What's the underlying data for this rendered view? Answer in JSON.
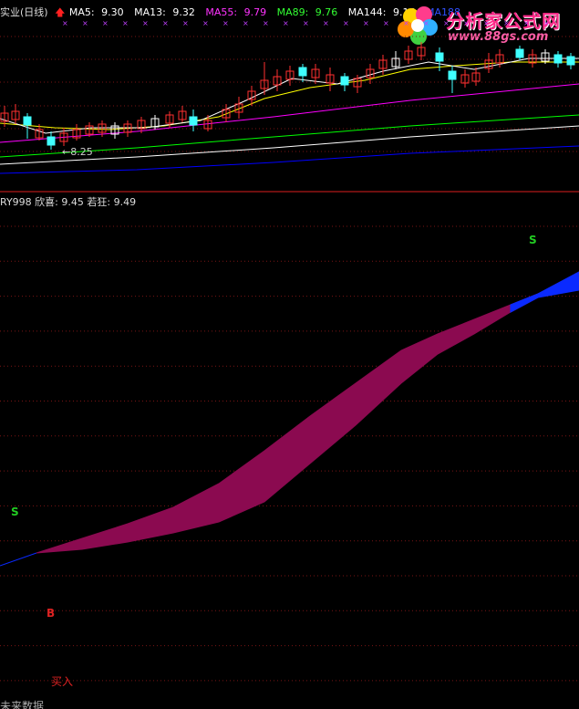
{
  "header": {
    "stock": "实业(日线)",
    "ma5_label": "MA5:",
    "ma5_value": "9.30",
    "ma13_label": "MA13:",
    "ma13_value": "9.32",
    "ma55_label": "MA55:",
    "ma55_value": "9.79",
    "ma89_label": "MA89:",
    "ma89_value": "9.76",
    "ma144_label": "MA144:",
    "ma144_value": "9.16",
    "ma188_label": "MA188",
    "low_marker": "8.25"
  },
  "indicator": {
    "name": "RY998",
    "label1": "欣喜:",
    "value1": "9.45",
    "label2": "若狂:",
    "value2": "9.49"
  },
  "signals": {
    "s_left": "S",
    "s_right": "S",
    "b": "B",
    "buy": "买入",
    "future": "未来数据"
  },
  "logo": {
    "title": "分析家公式网",
    "url": "www.88gs.com"
  },
  "colors": {
    "ma5": "#ffffff",
    "ma13": "#ffff00",
    "ma55": "#ff00ff",
    "ma89": "#00ff00",
    "ma144": "#ffffff",
    "ma188": "#0000ff",
    "ribbon_up": "#8b0a50",
    "ribbon_down": "#0a2aff"
  },
  "chart_data": [
    {
      "type": "line",
      "title": "实业(日线)",
      "series": [
        {
          "name": "MA5",
          "values": [
            9.3
          ]
        },
        {
          "name": "MA13",
          "values": [
            9.32
          ]
        },
        {
          "name": "MA55",
          "values": [
            9.79
          ]
        },
        {
          "name": "MA89",
          "values": [
            9.76
          ]
        },
        {
          "name": "MA144",
          "values": [
            9.16
          ]
        }
      ],
      "annotations": [
        "8.25"
      ]
    },
    {
      "type": "area",
      "title": "RY998",
      "series": [
        {
          "name": "欣喜",
          "values": [
            9.45
          ]
        },
        {
          "name": "若狂",
          "values": [
            9.49
          ]
        }
      ],
      "annotations": [
        "S",
        "S",
        "B",
        "买入",
        "未来数据"
      ]
    }
  ]
}
